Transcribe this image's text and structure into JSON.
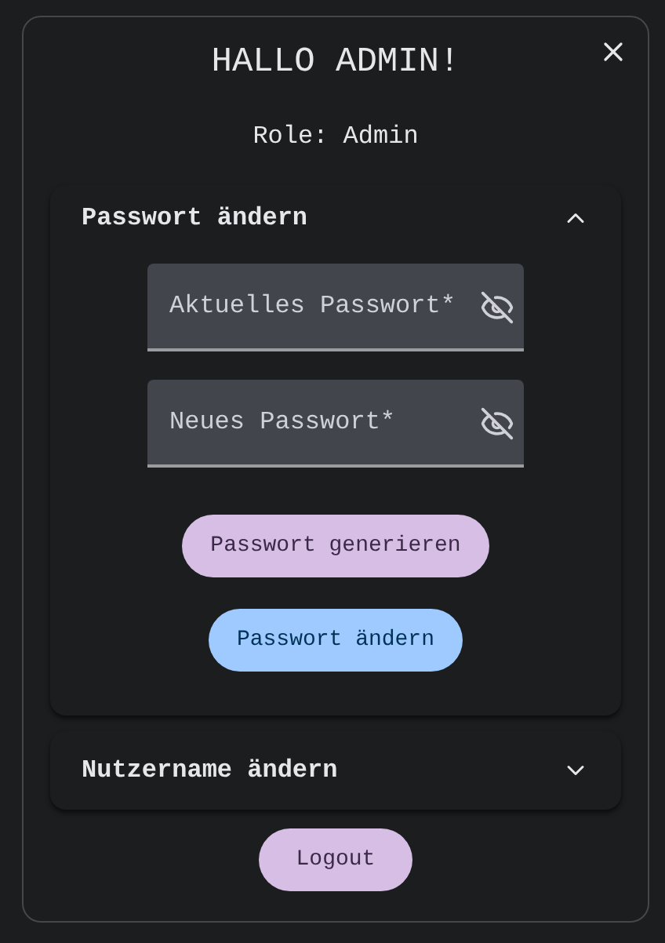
{
  "dialog": {
    "title": "HALLO ADMIN!",
    "role": "Role: Admin"
  },
  "sections": [
    {
      "title": "Passwort ändern",
      "expanded": true,
      "fields": [
        {
          "placeholder": "Aktuelles Passwort*"
        },
        {
          "placeholder": "Neues Passwort*"
        }
      ],
      "buttons": [
        {
          "label": "Passwort generieren",
          "kind": "secondary"
        },
        {
          "label": "Passwort ändern",
          "kind": "primary"
        }
      ]
    },
    {
      "title": "Nutzername ändern",
      "expanded": false
    }
  ],
  "logout": {
    "label": "Logout"
  }
}
